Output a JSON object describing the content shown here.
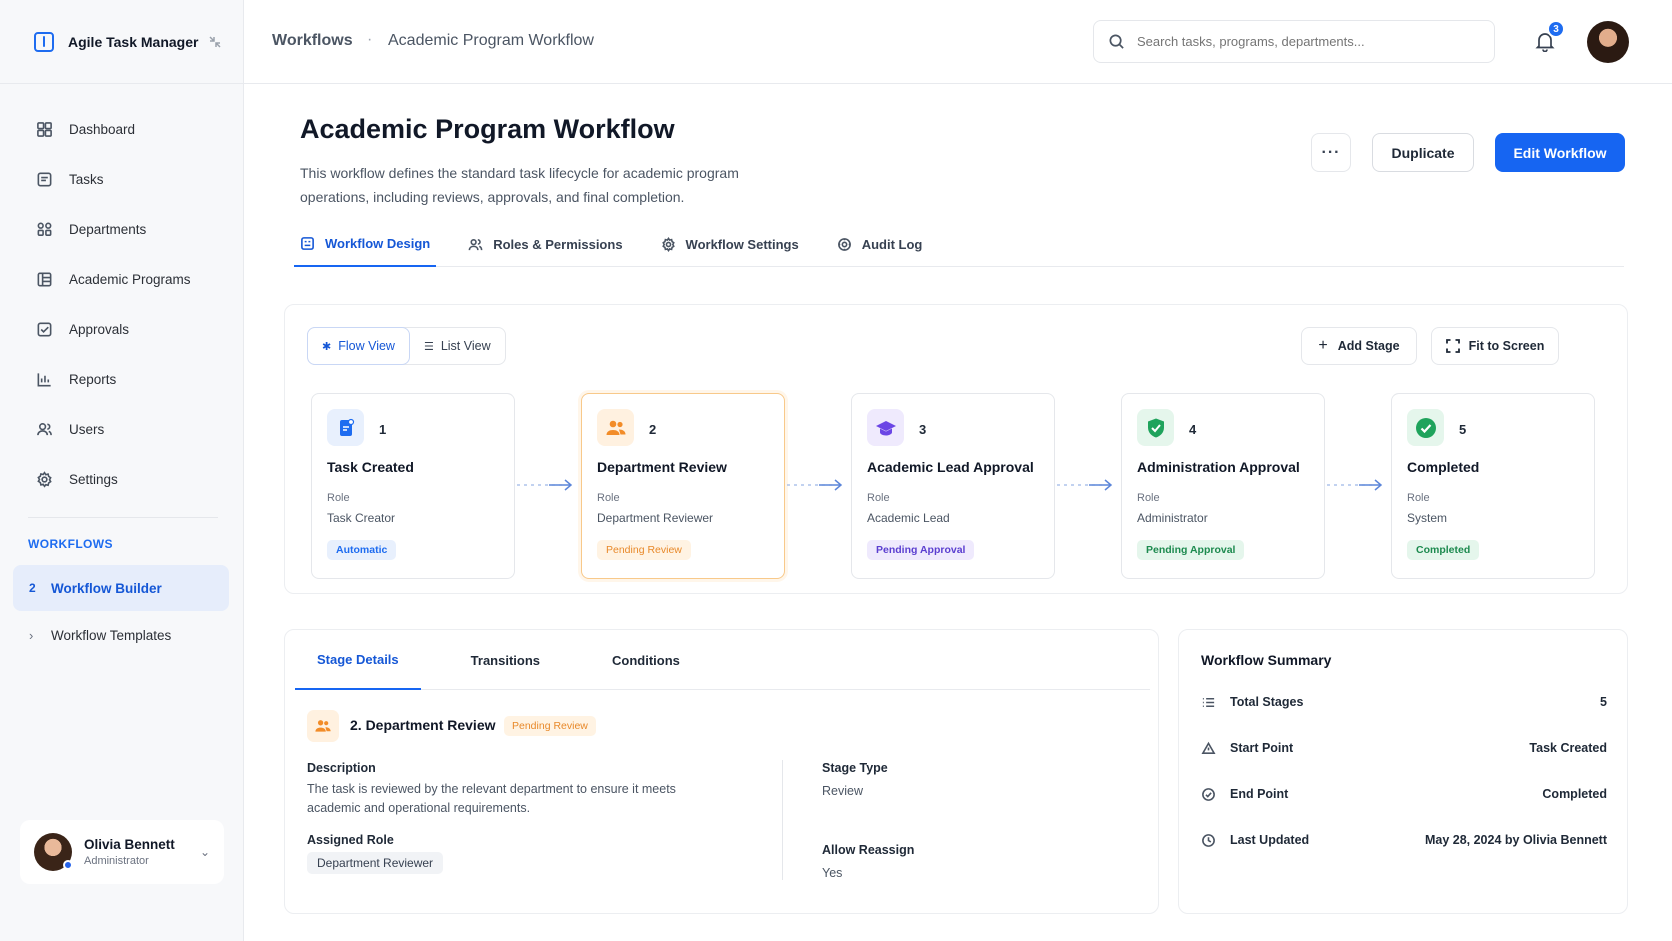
{
  "app": {
    "name": "Agile Task Manager"
  },
  "breadcrumb": {
    "section": "Workflows",
    "separator": "·",
    "page": "Academic Program Workflow"
  },
  "search": {
    "placeholder": "Search tasks, programs, departments..."
  },
  "notifications": {
    "count": "3"
  },
  "sidebar": {
    "items": [
      {
        "label": "Dashboard",
        "icon": "dashboard-icon"
      },
      {
        "label": "Tasks",
        "icon": "tasks-icon"
      },
      {
        "label": "Departments",
        "icon": "departments-icon"
      },
      {
        "label": "Academic Programs",
        "icon": "programs-icon"
      },
      {
        "label": "Approvals",
        "icon": "approvals-icon"
      },
      {
        "label": "Reports",
        "icon": "reports-icon"
      },
      {
        "label": "Users",
        "icon": "users-icon"
      },
      {
        "label": "Settings",
        "icon": "settings-icon"
      }
    ],
    "section_title": "WORKFLOWS",
    "workflow_items": [
      {
        "marker": "2",
        "label": "Workflow Builder"
      },
      {
        "marker": "›",
        "label": "Workflow Templates"
      }
    ],
    "user": {
      "name": "Olivia Bennett",
      "role": "Administrator"
    }
  },
  "page": {
    "title": "Academic Program Workflow",
    "description": "This workflow defines the standard task lifecycle for academic program operations, including reviews, approvals, and final completion.",
    "more_label": "···",
    "duplicate_label": "Duplicate",
    "edit_label": "Edit Workflow"
  },
  "tabs": [
    {
      "label": "Workflow Design"
    },
    {
      "label": "Roles & Permissions"
    },
    {
      "label": "Workflow Settings"
    },
    {
      "label": "Audit Log"
    }
  ],
  "flow": {
    "views": [
      {
        "label": "Flow View"
      },
      {
        "label": "List View"
      }
    ],
    "add_stage_label": "Add Stage",
    "fit_label": "Fit to Screen",
    "role_label": "Role",
    "stages": [
      {
        "num": "1",
        "name": "Task Created",
        "role": "Task Creator",
        "status": "Automatic",
        "color": "#1e6cf0",
        "badge_bg": "#e8f0fd",
        "badge_fg": "#1e6cf0"
      },
      {
        "num": "2",
        "name": "Department Review",
        "role": "Department Reviewer",
        "status": "Pending Review",
        "color": "#f28c28",
        "badge_bg": "#fff3e3",
        "badge_fg": "#e8892a"
      },
      {
        "num": "3",
        "name": "Academic Lead Approval",
        "role": "Academic Lead",
        "status": "Pending Approval",
        "color": "#6b46e5",
        "badge_bg": "#efeafd",
        "badge_fg": "#5b3fd0"
      },
      {
        "num": "4",
        "name": "Administration Approval",
        "role": "Administrator",
        "status": "Pending Approval",
        "color": "#1fa35c",
        "badge_bg": "#e5f6ec",
        "badge_fg": "#1d8a4f"
      },
      {
        "num": "5",
        "name": "Completed",
        "role": "System",
        "status": "Completed",
        "color": "#1fa35c",
        "badge_bg": "#e5f6ec",
        "badge_fg": "#1d8a4f"
      }
    ]
  },
  "details": {
    "tabs": [
      {
        "label": "Stage Details"
      },
      {
        "label": "Transitions"
      },
      {
        "label": "Conditions"
      }
    ],
    "title": "2. Department Review",
    "badge": "Pending Review",
    "description_label": "Description",
    "description": "The task is reviewed by the relevant department to ensure it meets academic and operational requirements.",
    "assigned_role_label": "Assigned Role",
    "assigned_role": "Department Reviewer",
    "stage_type_label": "Stage Type",
    "stage_type": "Review",
    "allow_reassign_label": "Allow Reassign",
    "allow_reassign": "Yes"
  },
  "summary": {
    "title": "Workflow Summary",
    "rows": [
      {
        "key": "Total Stages",
        "value": "5"
      },
      {
        "key": "Start Point",
        "value": "Task Created"
      },
      {
        "key": "End Point",
        "value": "Completed"
      },
      {
        "key": "Last Updated",
        "value": "May 28, 2024 by Olivia Bennett"
      }
    ]
  }
}
